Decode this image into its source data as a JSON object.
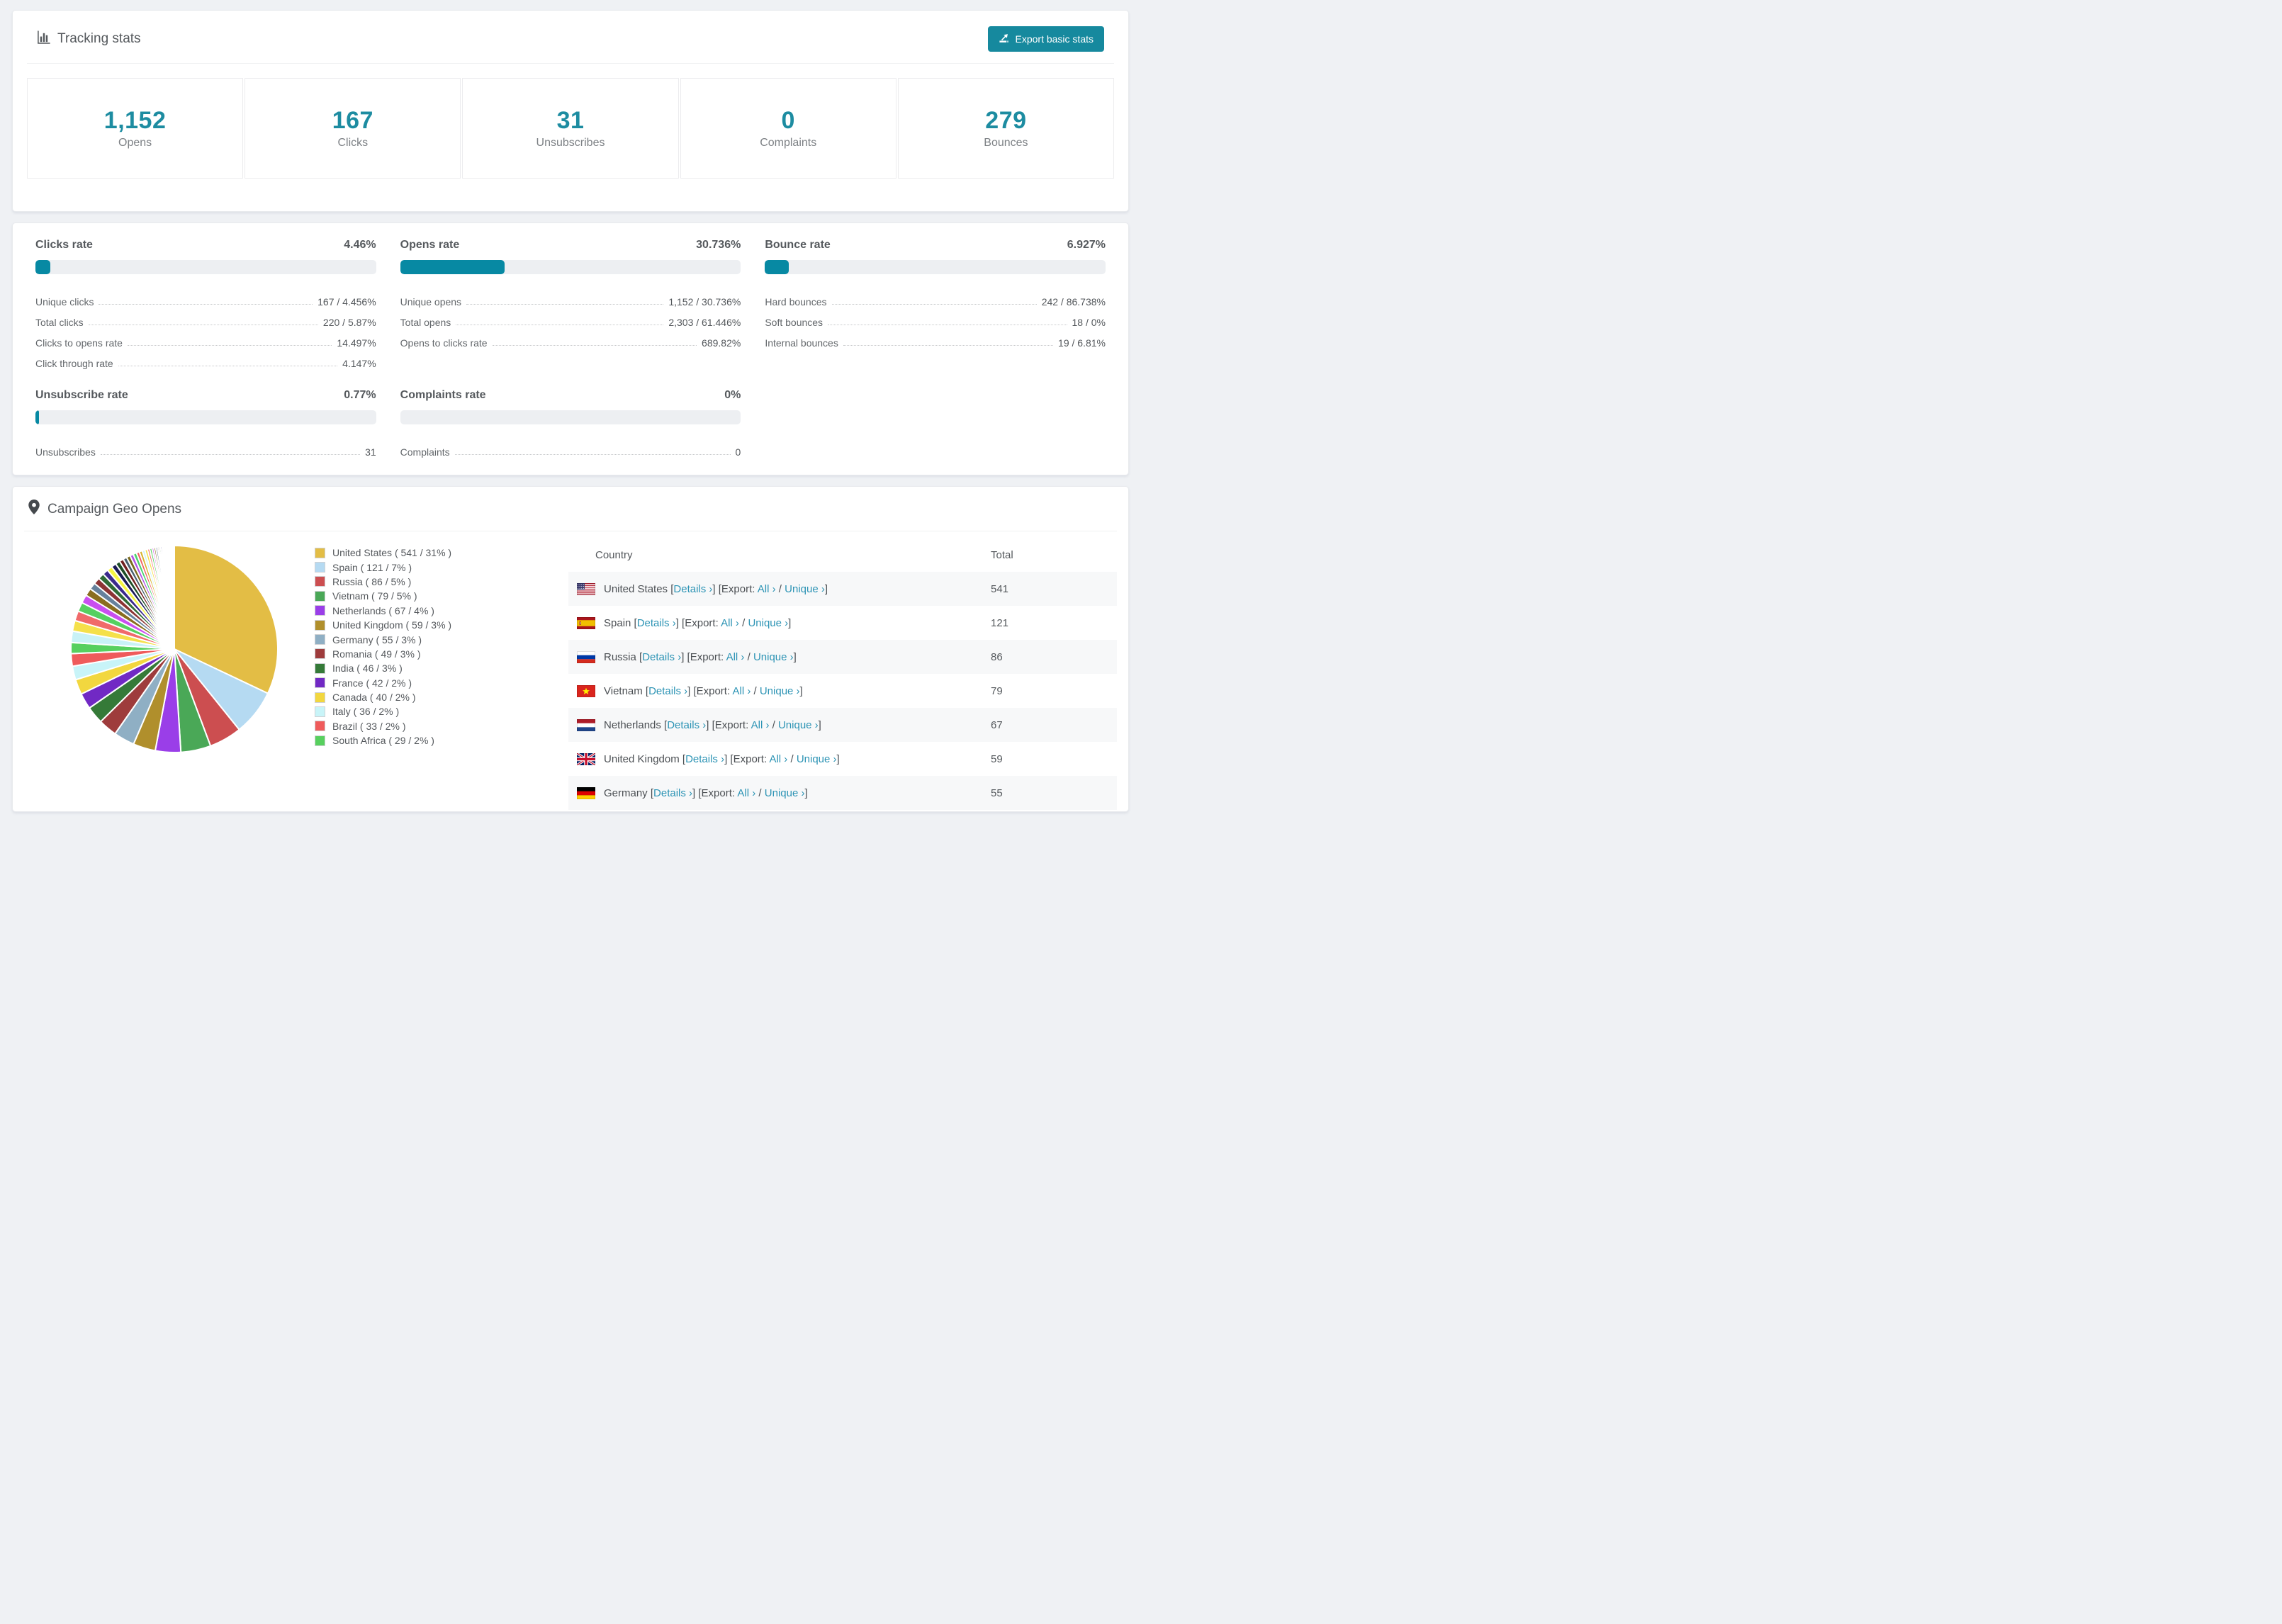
{
  "colors": {
    "accent": "#1d8ca1",
    "button": "#16899e",
    "bar_fill": "#0789a3",
    "link": "#2d94b5"
  },
  "tracking": {
    "title": "Tracking stats",
    "export_button": "Export basic stats",
    "stats": [
      {
        "value": "1,152",
        "label": "Opens"
      },
      {
        "value": "167",
        "label": "Clicks"
      },
      {
        "value": "31",
        "label": "Unsubscribes"
      },
      {
        "value": "0",
        "label": "Complaints"
      },
      {
        "value": "279",
        "label": "Bounces"
      }
    ]
  },
  "rates": {
    "panels": [
      {
        "title": "Clicks rate",
        "value": "4.46%",
        "pct": 4.46,
        "rows": [
          {
            "label": "Unique clicks",
            "value": "167 / 4.456%"
          },
          {
            "label": "Total clicks",
            "value": "220 / 5.87%"
          },
          {
            "label": "Clicks to opens rate",
            "value": "14.497%"
          },
          {
            "label": "Click through rate",
            "value": "4.147%"
          }
        ]
      },
      {
        "title": "Opens rate",
        "value": "30.736%",
        "pct": 30.736,
        "rows": [
          {
            "label": "Unique opens",
            "value": "1,152 / 30.736%"
          },
          {
            "label": "Total opens",
            "value": "2,303 / 61.446%"
          },
          {
            "label": "Opens to clicks rate",
            "value": "689.82%"
          }
        ]
      },
      {
        "title": "Bounce rate",
        "value": "6.927%",
        "pct": 6.927,
        "rows": [
          {
            "label": "Hard bounces",
            "value": "242 / 86.738%"
          },
          {
            "label": "Soft bounces",
            "value": "18 / 0%"
          },
          {
            "label": "Internal bounces",
            "value": "19 / 6.81%"
          }
        ]
      },
      {
        "title": "Unsubscribe rate",
        "value": "0.77%",
        "pct": 0.77,
        "rows": [
          {
            "label": "Unsubscribes",
            "value": "31"
          }
        ]
      },
      {
        "title": "Complaints rate",
        "value": "0%",
        "pct": 0,
        "rows": [
          {
            "label": "Complaints",
            "value": "0"
          }
        ]
      }
    ]
  },
  "geo": {
    "title": "Campaign Geo Opens",
    "links": {
      "details": "Details",
      "export": "Export:",
      "all": "All",
      "unique": "Unique",
      "arrow": "›"
    },
    "table": {
      "headers": [
        "Country",
        "Total"
      ],
      "rows": [
        {
          "country": "United States",
          "flag": "us",
          "total": "541"
        },
        {
          "country": "Spain",
          "flag": "es",
          "total": "121"
        },
        {
          "country": "Russia",
          "flag": "ru",
          "total": "86"
        },
        {
          "country": "Vietnam",
          "flag": "vn",
          "total": "79"
        },
        {
          "country": "Netherlands",
          "flag": "nl",
          "total": "67"
        },
        {
          "country": "United Kingdom",
          "flag": "gb",
          "total": "59"
        },
        {
          "country": "Germany",
          "flag": "de",
          "total": "55"
        }
      ]
    }
  },
  "chart_data": {
    "type": "pie",
    "title": "Campaign Geo Opens",
    "legend_position": "right",
    "start_angle_deg": -90,
    "direction": "clockwise",
    "series": [
      {
        "name": "United States",
        "value": 541,
        "pct": 31,
        "color": "#e3bd45"
      },
      {
        "name": "Spain",
        "value": 121,
        "pct": 7,
        "color": "#b5daf2"
      },
      {
        "name": "Russia",
        "value": 86,
        "pct": 5,
        "color": "#cc4e50"
      },
      {
        "name": "Vietnam",
        "value": 79,
        "pct": 5,
        "color": "#4aa857"
      },
      {
        "name": "Netherlands",
        "value": 67,
        "pct": 4,
        "color": "#9a3ee8"
      },
      {
        "name": "United Kingdom",
        "value": 59,
        "pct": 3,
        "color": "#b08f2c"
      },
      {
        "name": "Germany",
        "value": 55,
        "pct": 3,
        "color": "#8fafc4"
      },
      {
        "name": "Romania",
        "value": 49,
        "pct": 3,
        "color": "#9e3c3c"
      },
      {
        "name": "India",
        "value": 46,
        "pct": 3,
        "color": "#357a38"
      },
      {
        "name": "France",
        "value": 42,
        "pct": 2,
        "color": "#7129c4"
      },
      {
        "name": "Canada",
        "value": 40,
        "pct": 2,
        "color": "#f2d73f"
      },
      {
        "name": "Italy",
        "value": 36,
        "pct": 2,
        "color": "#c8f4f8"
      },
      {
        "name": "Brazil",
        "value": 33,
        "pct": 2,
        "color": "#ef5b5b"
      },
      {
        "name": "South Africa",
        "value": 29,
        "pct": 2,
        "color": "#57d05e"
      }
    ],
    "other_slices": {
      "values": [
        30,
        28,
        26,
        24,
        22,
        20,
        18,
        17,
        16,
        15,
        14,
        13,
        12,
        11,
        10,
        10,
        9,
        9,
        8,
        8,
        7,
        7,
        6,
        6,
        5,
        5,
        5,
        4,
        4,
        4,
        3,
        3,
        3,
        3,
        2,
        2,
        2,
        2,
        2,
        2,
        1,
        1,
        1,
        1,
        1,
        1,
        1,
        1
      ],
      "palette": [
        "#c9f2f6",
        "#f5e04a",
        "#f06a6a",
        "#56d060",
        "#c94ef0",
        "#8a6d1f",
        "#66819c",
        "#8c3434",
        "#2f6b36",
        "#3b2a8c",
        "#f5f542",
        "#1b1b56",
        "#1d4d26",
        "#702020",
        "#49606f",
        "#7a6a1e",
        "#b050e6",
        "#49d36e",
        "#ef6060",
        "#d8b430"
      ]
    }
  }
}
